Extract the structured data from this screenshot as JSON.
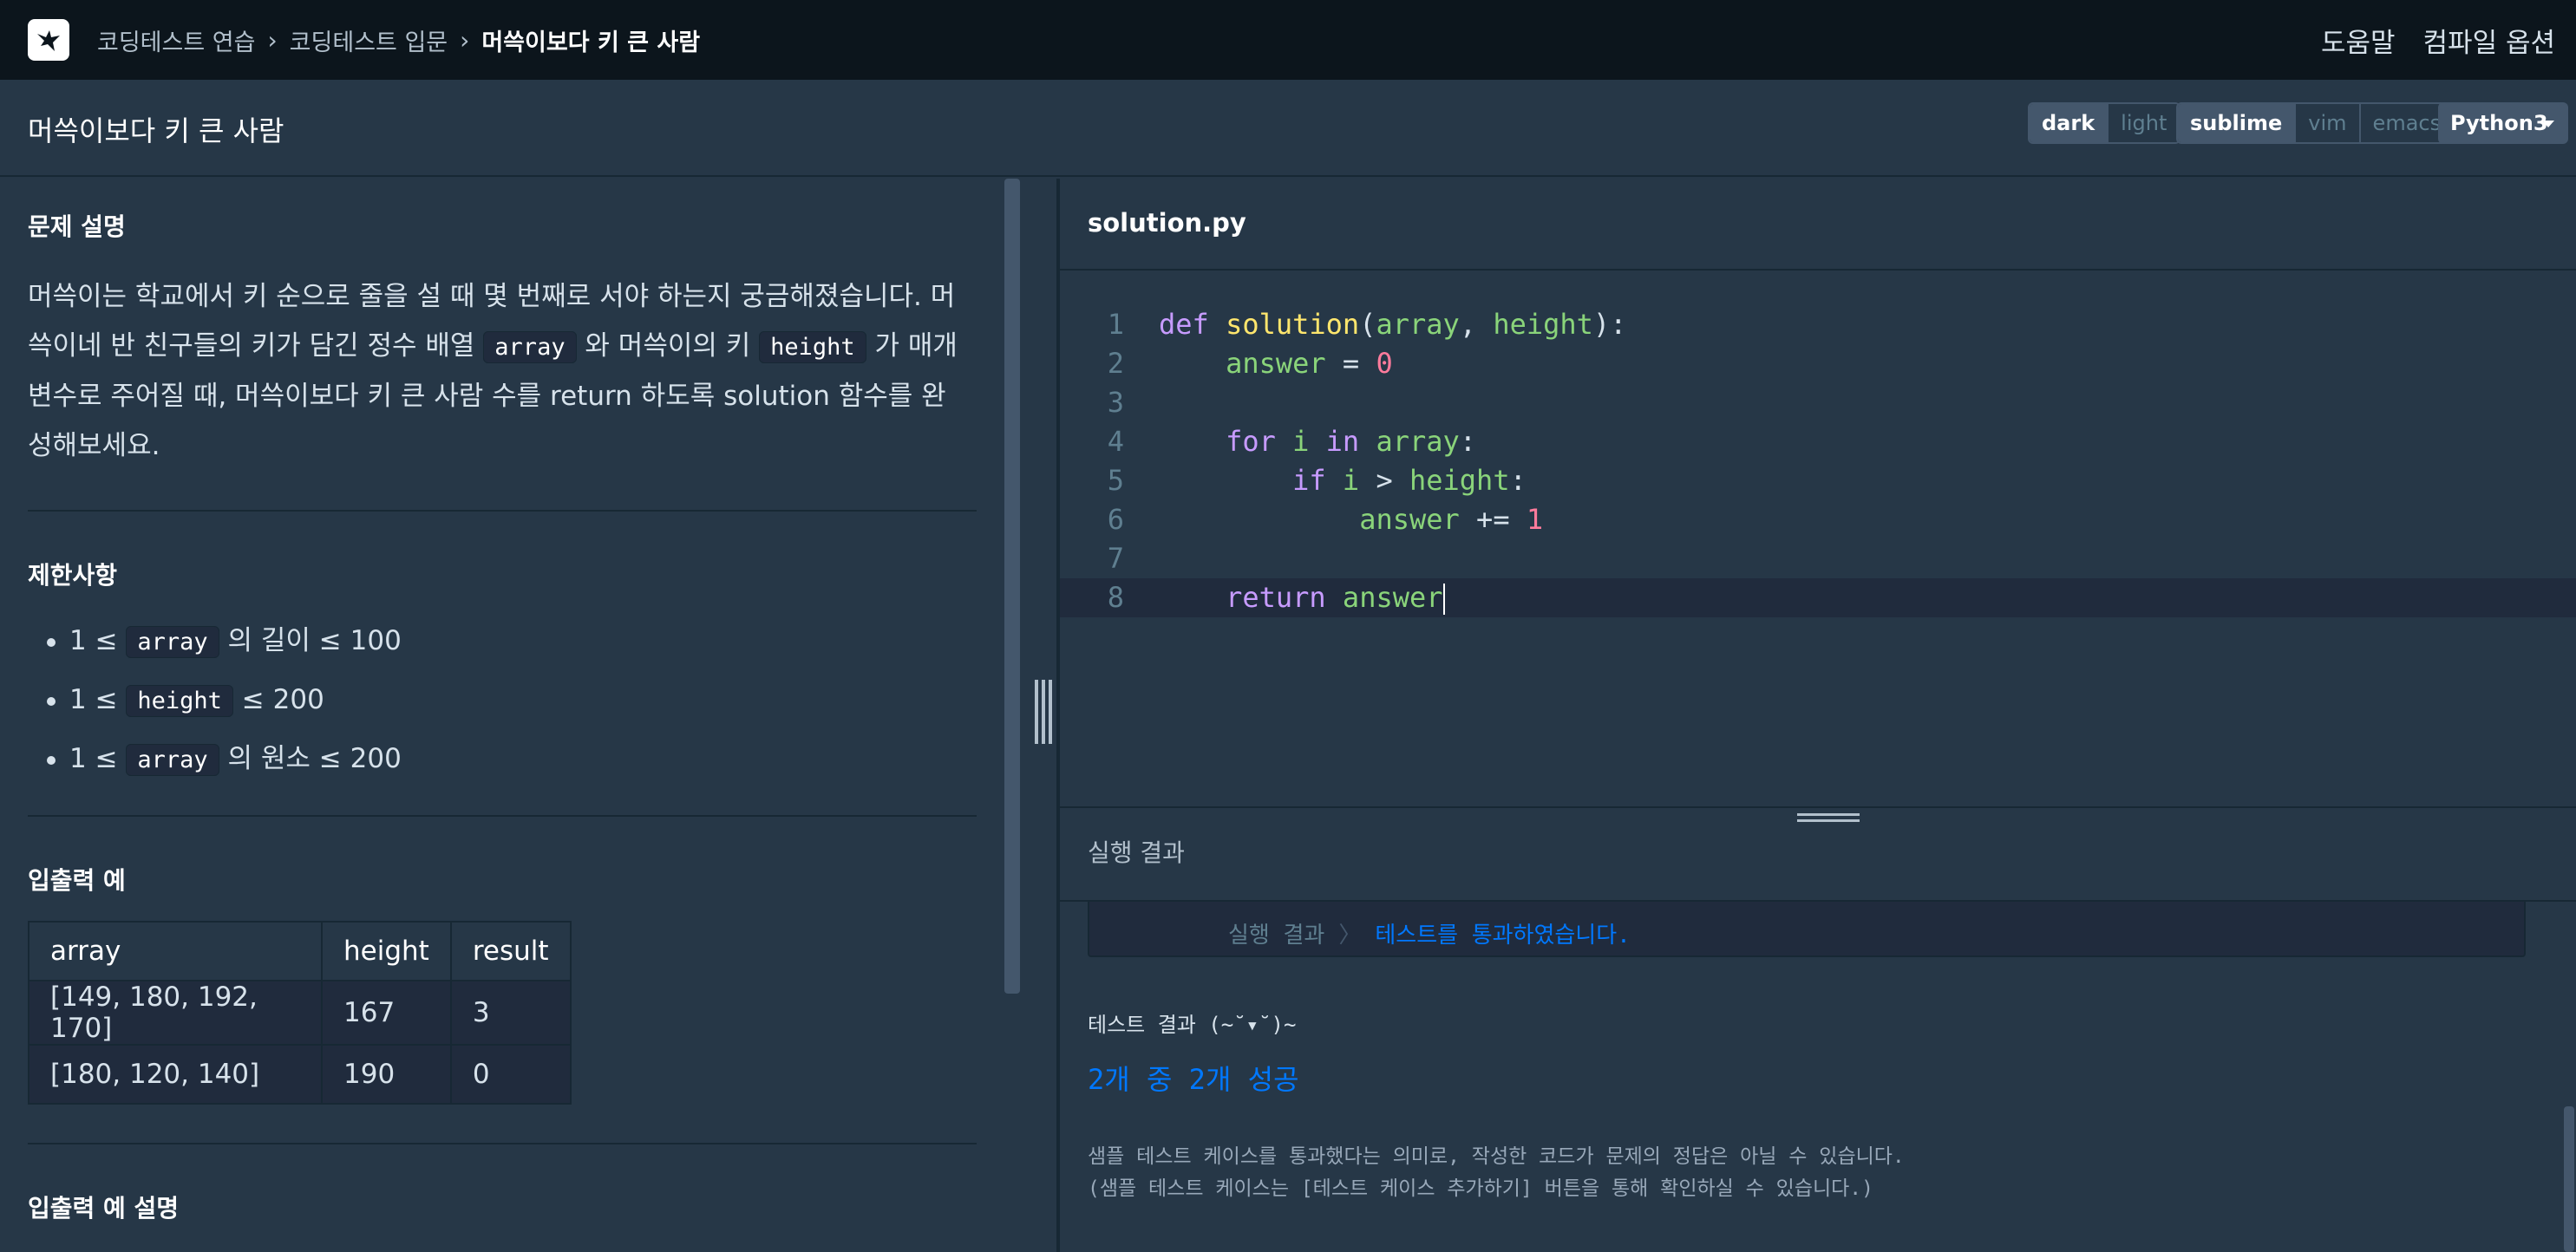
{
  "nav": {
    "crumbs": [
      "코딩테스트 연습",
      "코딩테스트 입문",
      "머쓱이보다 키 큰 사람"
    ],
    "help": "도움말",
    "compile_options": "컴파일 옵션"
  },
  "header": {
    "title": "머쓱이보다 키 큰 사람",
    "theme": {
      "dark": "dark",
      "light": "light",
      "selected": "dark"
    },
    "keymap": {
      "sublime": "sublime",
      "vim": "vim",
      "emacs": "emacs",
      "selected": "sublime"
    },
    "language": "Python3"
  },
  "problem": {
    "desc_heading": "문제 설명",
    "desc": {
      "p1": "머쓱이는 학교에서 키 순으로 줄을 설 때 몇 번째로 서야 하는지 궁금해졌습니다. 머쓱이네 반 친구들의 키가 담긴 정수 배열 ",
      "code1": "array",
      "p2": " 와 머쓱이의 키 ",
      "code2": "height",
      "p3": " 가 매개변수로 주어질 때, 머쓱이보다 키 큰 사람 수를 return 하도록 solution 함수를 완성해보세요."
    },
    "limits_heading": "제한사항",
    "limits": [
      {
        "pre": "1 ≤ ",
        "code": "array",
        "post": " 의 길이 ≤ 100"
      },
      {
        "pre": "1 ≤ ",
        "code": "height",
        "post": " ≤ 200"
      },
      {
        "pre": "1 ≤ ",
        "code": "array",
        "post": " 의 원소 ≤ 200"
      }
    ],
    "io_heading": "입출력 예",
    "io_table": {
      "headers": [
        "array",
        "height",
        "result"
      ],
      "rows": [
        [
          "[149, 180, 192, 170]",
          "167",
          "3"
        ],
        [
          "[180, 120, 140]",
          "190",
          "0"
        ]
      ]
    },
    "io_explain_heading": "입출력 예 설명"
  },
  "editor": {
    "filename": "solution.py",
    "line_numbers": [
      "1",
      "2",
      "3",
      "4",
      "5",
      "6",
      "7",
      "8"
    ]
  },
  "results": {
    "heading": "실행 결과",
    "result_label": "실행 결과",
    "result_value": "테스트를 통과하였습니다.",
    "test_summary": "테스트 결과 (~˘▾˘)~",
    "pass_count": "2개 중 2개 성공",
    "note_line1": "샘플 테스트 케이스를 통과했다는 의미로, 작성한 코드가 문제의 정답은 아닐 수 있습니다.",
    "note_line2": "(샘플 테스트 케이스는 [테스트 케이스 추가하기] 버튼을 통해 확인하실 수 있습니다.)"
  },
  "colors": {
    "accent": "#0078ff",
    "bg": "#263747",
    "nav_bg": "#0c151c"
  }
}
